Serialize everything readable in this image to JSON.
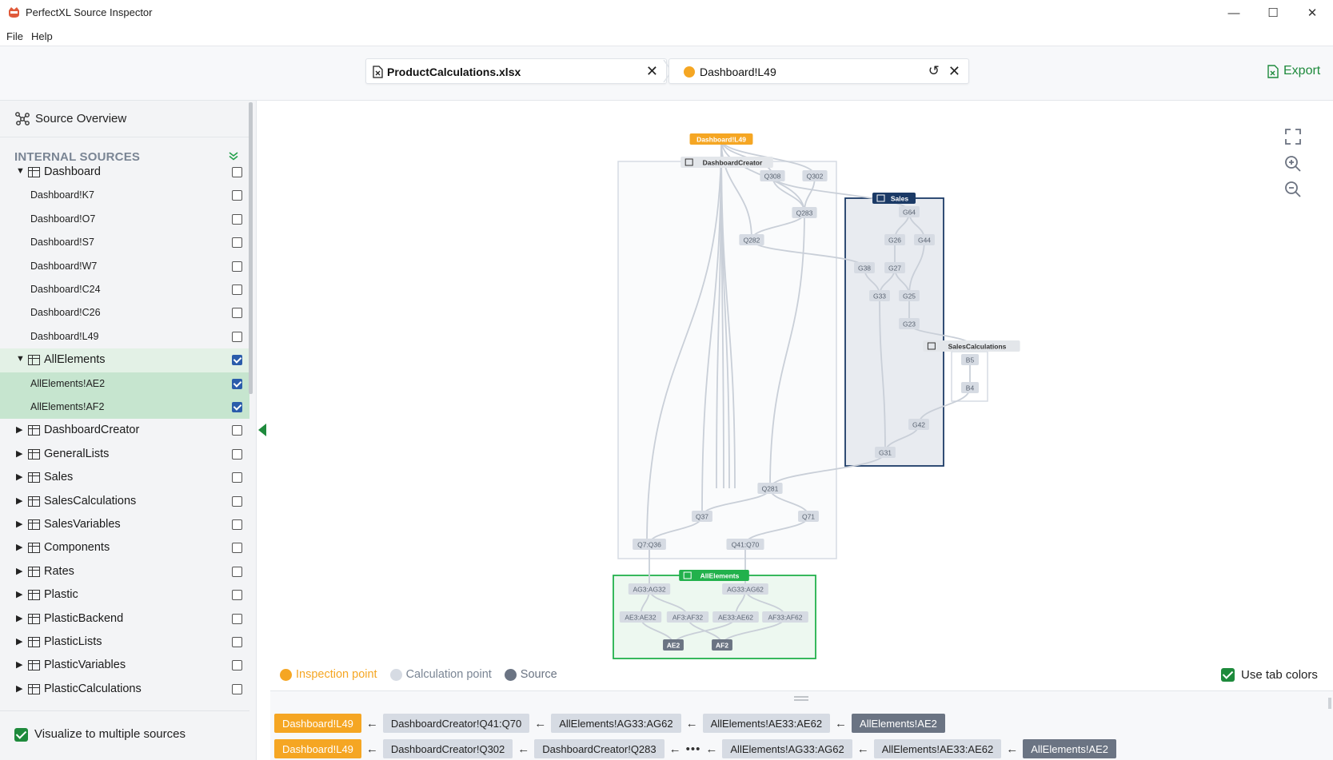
{
  "window": {
    "title": "PerfectXL Source Inspector",
    "controls": [
      "—",
      "☐",
      "✕"
    ]
  },
  "menu": [
    "File",
    "Help"
  ],
  "tabs": {
    "file": "ProductCalculations.xlsx",
    "cell": "Dashboard!L49",
    "export": "Export"
  },
  "sidebar": {
    "overview": "Source Overview",
    "internal_header": "INTERNAL SOURCES",
    "visualize_label": "Visualize to multiple sources"
  },
  "tree": [
    {
      "label": "Dashboard",
      "kind": "sheet",
      "expanded": true,
      "checked": false
    },
    {
      "label": "Dashboard!K7",
      "kind": "cell",
      "checked": false
    },
    {
      "label": "Dashboard!O7",
      "kind": "cell",
      "checked": false
    },
    {
      "label": "Dashboard!S7",
      "kind": "cell",
      "checked": false
    },
    {
      "label": "Dashboard!W7",
      "kind": "cell",
      "checked": false
    },
    {
      "label": "Dashboard!C24",
      "kind": "cell",
      "checked": false
    },
    {
      "label": "Dashboard!C26",
      "kind": "cell",
      "checked": false
    },
    {
      "label": "Dashboard!L49",
      "kind": "cell",
      "checked": false
    },
    {
      "label": "AllElements",
      "kind": "sheet",
      "expanded": true,
      "checked": true
    },
    {
      "label": "AllElements!AE2",
      "kind": "cell",
      "checked": true
    },
    {
      "label": "AllElements!AF2",
      "kind": "cell",
      "checked": true
    },
    {
      "label": "DashboardCreator",
      "kind": "sheet",
      "expanded": false,
      "checked": false
    },
    {
      "label": "GeneralLists",
      "kind": "sheet",
      "expanded": false,
      "checked": false
    },
    {
      "label": "Sales",
      "kind": "sheet",
      "expanded": false,
      "checked": false
    },
    {
      "label": "SalesCalculations",
      "kind": "sheet",
      "expanded": false,
      "checked": false
    },
    {
      "label": "SalesVariables",
      "kind": "sheet",
      "expanded": false,
      "checked": false
    },
    {
      "label": "Components",
      "kind": "sheet",
      "expanded": false,
      "checked": false
    },
    {
      "label": "Rates",
      "kind": "sheet",
      "expanded": false,
      "checked": false
    },
    {
      "label": "Plastic",
      "kind": "sheet",
      "expanded": false,
      "checked": false
    },
    {
      "label": "PlasticBackend",
      "kind": "sheet",
      "expanded": false,
      "checked": false
    },
    {
      "label": "PlasticLists",
      "kind": "sheet",
      "expanded": false,
      "checked": false
    },
    {
      "label": "PlasticVariables",
      "kind": "sheet",
      "expanded": false,
      "checked": false
    },
    {
      "label": "PlasticCalculations",
      "kind": "sheet",
      "expanded": false,
      "checked": false
    }
  ],
  "graph": {
    "inspection_label": "Dashboard!L49",
    "groups": [
      "DashboardCreator",
      "Sales",
      "SalesCalculations",
      "AllElements"
    ],
    "nodes": [
      "Q308",
      "Q302",
      "Q283",
      "Q282",
      "Q281",
      "Q37",
      "Q71",
      "Q7:Q36",
      "Q41:Q70",
      "G64",
      "G26",
      "G44",
      "G38",
      "G27",
      "G33",
      "G25",
      "G23",
      "G42",
      "G31",
      "B5",
      "B4",
      "AG3:AG32",
      "AG33:AG62",
      "AE3:AE32",
      "AF3:AF32",
      "AE33:AE62",
      "AF33:AF62",
      "AE2",
      "AF2"
    ]
  },
  "legend": {
    "inspection": "Inspection point",
    "calculation": "Calculation point",
    "source": "Source",
    "use_tab_colors": "Use tab colors"
  },
  "colors": {
    "inspection": "#f5a623",
    "calculation": "#d6dbe3",
    "source": "#6b7483",
    "accent": "#1e8a3c",
    "sales": "#1b3a66"
  },
  "paths": [
    [
      "Dashboard!L49",
      "DashboardCreator!Q41:Q70",
      "AllElements!AG33:AG62",
      "AllElements!AE33:AE62",
      "AllElements!AE2"
    ],
    [
      "Dashboard!L49",
      "DashboardCreator!Q302",
      "DashboardCreator!Q283",
      "•••",
      "AllElements!AG33:AG62",
      "AllElements!AE33:AE62",
      "AllElements!AE2"
    ]
  ]
}
